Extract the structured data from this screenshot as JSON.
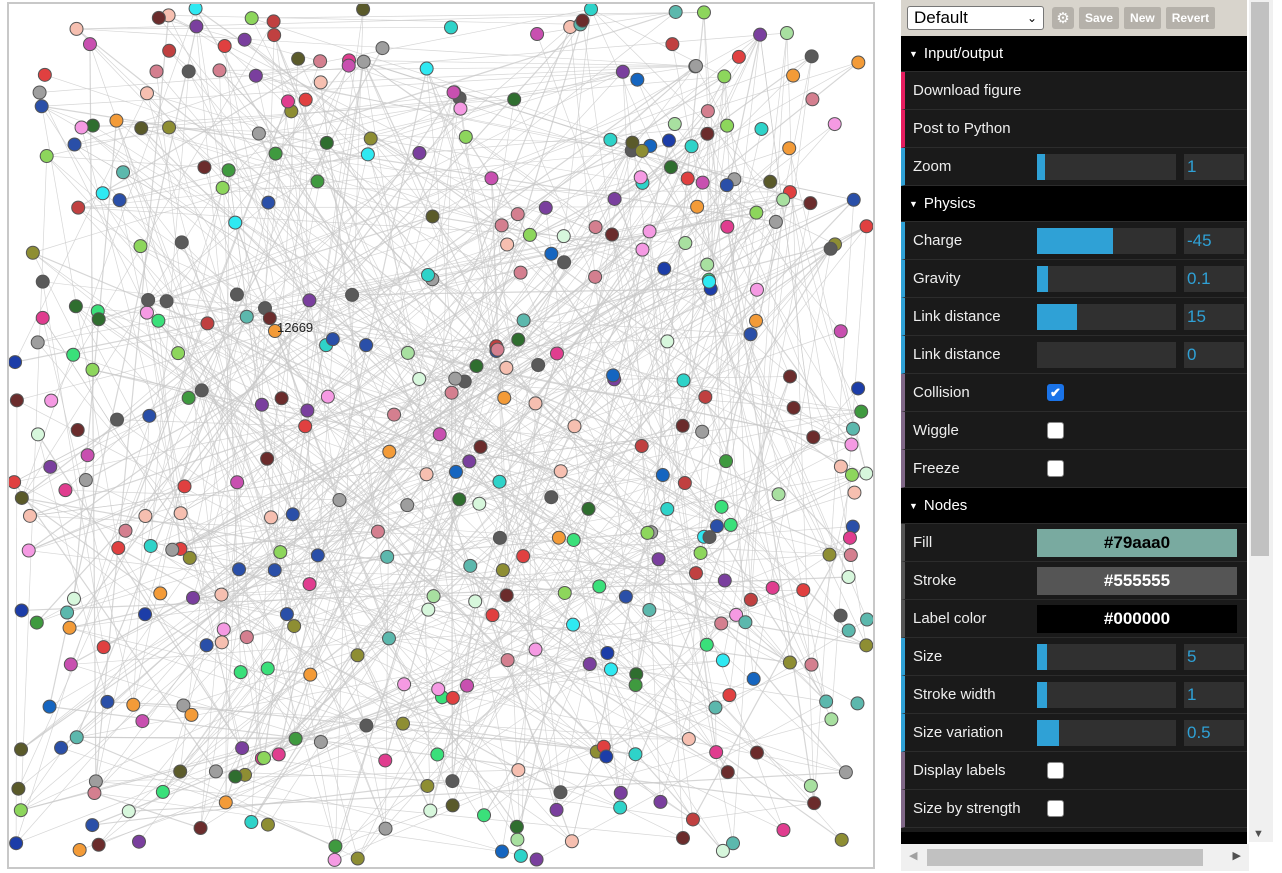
{
  "graph": {
    "hover_label": "12669",
    "link_color": "#c8c8c8",
    "node_stroke": "#555555",
    "node_palette": [
      "#3f9a3f",
      "#e04040",
      "#d47f8f",
      "#2ed3c9",
      "#8e8e33",
      "#f39b38",
      "#5a5a5a",
      "#f6bfb0",
      "#c850b0",
      "#7a3f9e",
      "#2a4fa8",
      "#6b2c2c",
      "#3ae07a",
      "#2f6e2f",
      "#a8e0a0",
      "#2fe9f2",
      "#e03d8f",
      "#f59ae3",
      "#1565c0",
      "#8dd65c",
      "#5a5a2a",
      "#d7f7dc",
      "#9e9e9e",
      "#c04040",
      "#1c3da8",
      "#5cb8ad"
    ],
    "nodes_with_label": [
      {
        "id": "12669"
      }
    ]
  },
  "gui": {
    "preset": {
      "selected": "Default",
      "gear_icon": "gear-icon",
      "save": "Save",
      "new": "New",
      "revert": "Revert"
    },
    "folders": [
      {
        "title": "Input/output",
        "rows": [
          {
            "type": "func",
            "label": "Download figure"
          },
          {
            "type": "func",
            "label": "Post to Python"
          },
          {
            "type": "num",
            "label": "Zoom",
            "value": "1",
            "fill": 0.06
          }
        ]
      },
      {
        "title": "Physics",
        "rows": [
          {
            "type": "num",
            "label": "Charge",
            "value": "-45",
            "fill": 0.55
          },
          {
            "type": "num",
            "label": "Gravity",
            "value": "0.1",
            "fill": 0.08
          },
          {
            "type": "num",
            "label": "Link distance",
            "value": "15",
            "fill": 0.29
          },
          {
            "type": "num",
            "label": "Link distance",
            "value": "0",
            "fill": 0.0
          },
          {
            "type": "bool",
            "label": "Collision",
            "checked": true
          },
          {
            "type": "bool",
            "label": "Wiggle",
            "checked": false
          },
          {
            "type": "bool",
            "label": "Freeze",
            "checked": false
          }
        ]
      },
      {
        "title": "Nodes",
        "rows": [
          {
            "type": "color",
            "label": "Fill",
            "value": "#79aaa0"
          },
          {
            "type": "color",
            "label": "Stroke",
            "value": "#555555"
          },
          {
            "type": "color",
            "label": "Label color",
            "value": "#000000"
          },
          {
            "type": "num",
            "label": "Size",
            "value": "5",
            "fill": 0.07
          },
          {
            "type": "num",
            "label": "Stroke width",
            "value": "1",
            "fill": 0.07
          },
          {
            "type": "num",
            "label": "Size variation",
            "value": "0.5",
            "fill": 0.16
          },
          {
            "type": "bool",
            "label": "Display labels",
            "checked": false
          },
          {
            "type": "bool",
            "label": "Size by strength",
            "checked": false
          }
        ]
      }
    ]
  },
  "icons": {
    "triangle": "folder-open-icon",
    "check": "checkmark-icon",
    "scroll_down": "scroll-down-icon",
    "scroll_left": "scroll-left-icon",
    "scroll_right": "scroll-right-icon",
    "select_chevron": "chevron-down-icon"
  }
}
